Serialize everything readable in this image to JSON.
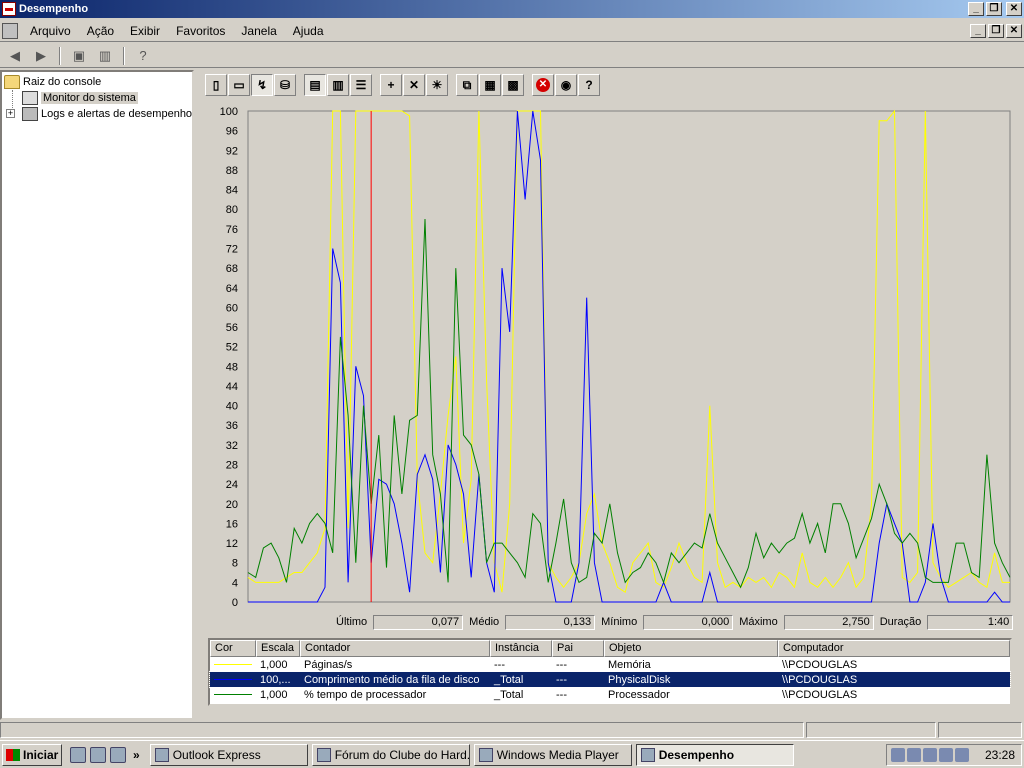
{
  "window": {
    "title": "Desempenho",
    "min_glyph": "_",
    "restore_glyph": "❐",
    "close_glyph": "✕"
  },
  "menubar": {
    "items": [
      "Arquivo",
      "Ação",
      "Exibir",
      "Favoritos",
      "Janela",
      "Ajuda"
    ]
  },
  "tree": {
    "root": "Raiz do console",
    "children": [
      "Monitor do sistema",
      "Logs e alertas de desempenho"
    ],
    "expander_glyph": "+"
  },
  "stats": {
    "last_label": "Último",
    "last_value": "0,077",
    "avg_label": "Médio",
    "avg_value": "0,133",
    "min_label": "Mínimo",
    "min_value": "0,000",
    "max_label": "Máximo",
    "max_value": "2,750",
    "dur_label": "Duração",
    "dur_value": "1:40"
  },
  "legend": {
    "headers": [
      "Cor",
      "Escala",
      "Contador",
      "Instância",
      "Pai",
      "Objeto",
      "Computador"
    ],
    "rows": [
      {
        "color": "#ffff00",
        "scale": "1,000",
        "counter": "Páginas/s",
        "instance": "---",
        "parent": "---",
        "object": "Memória",
        "computer": "\\\\PCDOUGLAS"
      },
      {
        "color": "#0000ff",
        "scale": "100,...",
        "counter": "Comprimento médio da fila de disco",
        "instance": "_Total",
        "parent": "---",
        "object": "PhysicalDisk",
        "computer": "\\\\PCDOUGLAS"
      },
      {
        "color": "#008000",
        "scale": "1,000",
        "counter": "% tempo de processador",
        "instance": "_Total",
        "parent": "---",
        "object": "Processador",
        "computer": "\\\\PCDOUGLAS"
      }
    ]
  },
  "taskbar": {
    "start_label": "Iniciar",
    "quick_chevron": "»",
    "tasks": [
      "Outlook Express",
      "Fórum do Clube do Hard...",
      "Windows Media Player",
      "Desempenho"
    ],
    "clock": "23:28"
  },
  "chart_data": {
    "type": "line",
    "yticks": [
      0,
      4,
      8,
      12,
      16,
      20,
      24,
      28,
      32,
      36,
      40,
      44,
      48,
      52,
      56,
      60,
      64,
      68,
      72,
      76,
      80,
      84,
      88,
      92,
      96,
      100
    ],
    "ylim": [
      0,
      100
    ],
    "grid": false,
    "x_count": 100,
    "cursor_index": 16,
    "series": [
      {
        "color": "#ffff00",
        "values": [
          5,
          4,
          4,
          4,
          4,
          5,
          6,
          6,
          8,
          10,
          15,
          100,
          100,
          15,
          100,
          100,
          100,
          100,
          100,
          100,
          100,
          99,
          25,
          10,
          8,
          22,
          38,
          50,
          12,
          25,
          100,
          45,
          8,
          2,
          20,
          100,
          100,
          100,
          100,
          8,
          5,
          3,
          5,
          8,
          18,
          22,
          12,
          8,
          3,
          2,
          8,
          10,
          12,
          4,
          3,
          7,
          12,
          8,
          5,
          4,
          40,
          8,
          3,
          4,
          3,
          5,
          4,
          5,
          3,
          6,
          5,
          3,
          10,
          4,
          3,
          5,
          3,
          5,
          8,
          3,
          5,
          20,
          98,
          98,
          100,
          5,
          4,
          6,
          100,
          8,
          5,
          3,
          4,
          5,
          6,
          4,
          3,
          10,
          4,
          4
        ]
      },
      {
        "color": "#0000ff",
        "values": [
          0,
          0,
          0,
          0,
          0,
          0,
          0,
          0,
          0,
          0,
          3,
          72,
          65,
          4,
          48,
          42,
          8,
          25,
          24,
          20,
          12,
          2,
          26,
          30,
          25,
          6,
          32,
          28,
          22,
          5,
          26,
          8,
          2,
          68,
          55,
          100,
          82,
          100,
          90,
          8,
          0,
          0,
          0,
          8,
          62,
          8,
          0,
          0,
          0,
          0,
          0,
          0,
          0,
          0,
          4,
          0,
          0,
          0,
          0,
          0,
          6,
          0,
          0,
          0,
          0,
          0,
          0,
          0,
          0,
          0,
          0,
          0,
          0,
          0,
          0,
          0,
          0,
          0,
          0,
          0,
          0,
          0,
          12,
          20,
          16,
          12,
          0,
          0,
          4,
          16,
          5,
          0,
          0,
          0,
          0,
          0,
          0,
          2,
          0,
          0
        ]
      },
      {
        "color": "#008000",
        "values": [
          6,
          5,
          11,
          12,
          9,
          4,
          15,
          12,
          16,
          18,
          16,
          10,
          54,
          38,
          8,
          40,
          20,
          34,
          7,
          38,
          22,
          37,
          38,
          78,
          30,
          22,
          4,
          68,
          34,
          32,
          26,
          8,
          12,
          12,
          10,
          8,
          5,
          18,
          16,
          4,
          12,
          21,
          8,
          4,
          5,
          14,
          12,
          20,
          10,
          4,
          6,
          7,
          10,
          8,
          4,
          10,
          8,
          10,
          12,
          11,
          18,
          12,
          9,
          6,
          3,
          7,
          14,
          9,
          12,
          10,
          12,
          13,
          18,
          12,
          16,
          10,
          20,
          20,
          16,
          9,
          13,
          17,
          24,
          20,
          14,
          12,
          14,
          12,
          5,
          4,
          4,
          4,
          12,
          12,
          6,
          5,
          30,
          12,
          8,
          5
        ]
      }
    ]
  },
  "colors": {
    "titlebar_start": "#0a246a",
    "titlebar_end": "#a6caf0",
    "chart_bg": "#d4d0c8",
    "cursor": "#ff0000",
    "selection": "#0a246a"
  }
}
